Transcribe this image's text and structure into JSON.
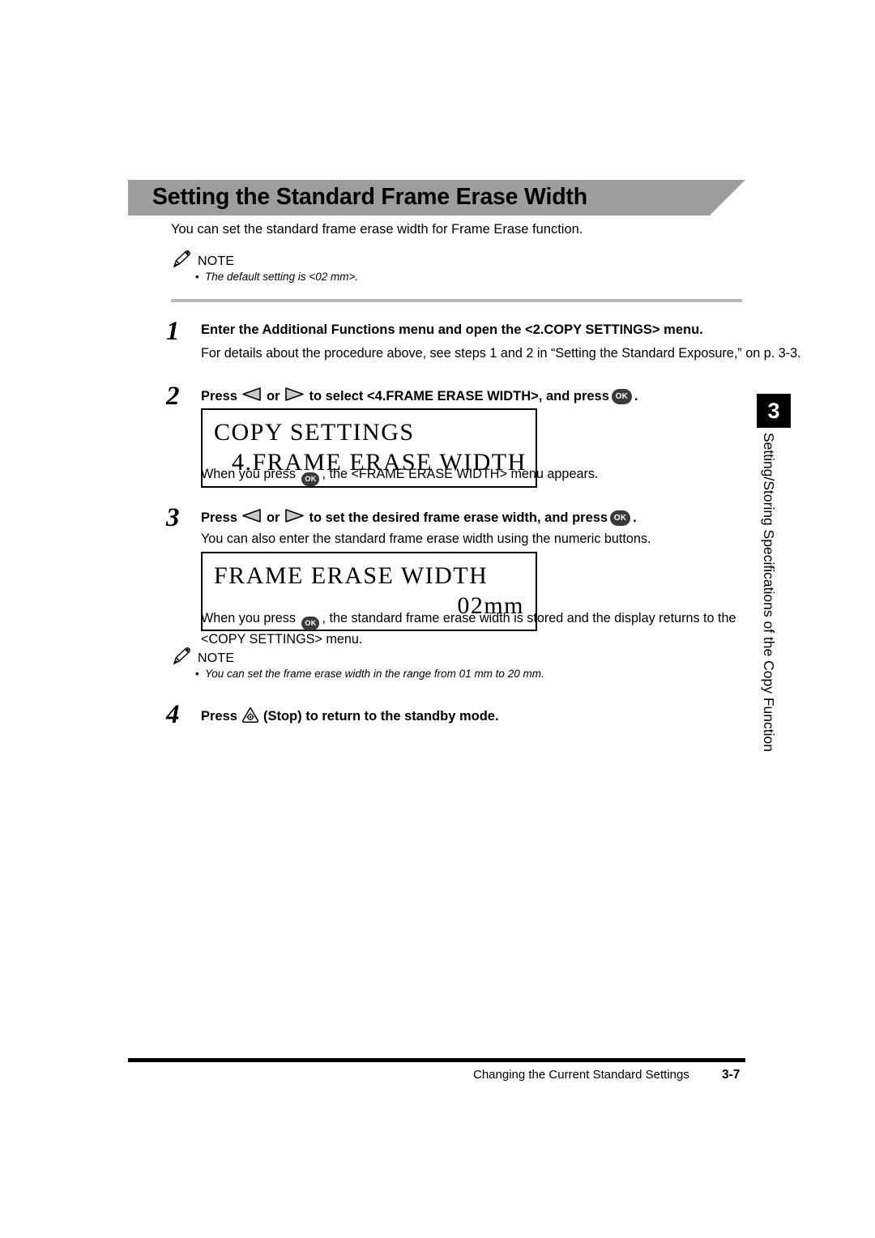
{
  "header": {
    "title": "Setting the Standard Frame Erase Width"
  },
  "intro": "You can set the standard frame erase width for Frame Erase function.",
  "notes": [
    {
      "label": "NOTE",
      "icon": "pencil-icon",
      "bullets": [
        "The default setting is <02 mm>."
      ]
    },
    {
      "label": "NOTE",
      "icon": "pencil-icon",
      "bullets": [
        "You can set the frame erase width in the range from 01 mm to 20 mm."
      ]
    }
  ],
  "steps": [
    {
      "number": "1",
      "heading": "Enter the Additional Functions menu and open the <2.COPY SETTINGS> menu.",
      "body": "For details about the procedure above, see steps 1 and 2 in “Setting the Standard Exposure,” on p. 3-3."
    },
    {
      "number": "2",
      "heading_parts": {
        "pre": "Press",
        "mid": "or",
        "post": "to select <4.FRAME ERASE WIDTH>, and press",
        "end": "."
      },
      "body_pre": "When you press",
      "body_post": ", the <FRAME ERASE WIDTH> menu appears."
    },
    {
      "number": "3",
      "heading_parts": {
        "pre": "Press",
        "mid": "or",
        "post": "to set the desired frame erase width, and press",
        "end": "."
      },
      "body": "You can also enter the standard frame erase width using the numeric buttons.",
      "body2_pre": "When you press",
      "body2_post": ", the standard frame erase width is stored and the display returns to the <COPY SETTINGS> menu."
    },
    {
      "number": "4",
      "heading_parts": {
        "pre": "Press",
        "post": "(Stop) to return to the standby mode."
      }
    }
  ],
  "lcd_displays": [
    {
      "line1": "COPY SETTINGS",
      "line2": "4.FRAME ERASE WIDTH"
    },
    {
      "line1": "FRAME ERASE WIDTH",
      "line2": "02mm"
    }
  ],
  "keys": {
    "ok_label": "OK",
    "left_arrow": "left-arrow-key",
    "right_arrow": "right-arrow-key",
    "stop": "stop-key"
  },
  "side_tab": {
    "number": "3",
    "text": "Setting/Storing Specifications of the Copy Function"
  },
  "footer": {
    "chapter": "Changing the Current Standard Settings",
    "page": "3-7"
  },
  "colors": {
    "banner": "#9d9d9d",
    "rule": "#b9b9b9",
    "key_dark": "#3a3a3a",
    "arrow_fill": "#c9c9c9"
  }
}
